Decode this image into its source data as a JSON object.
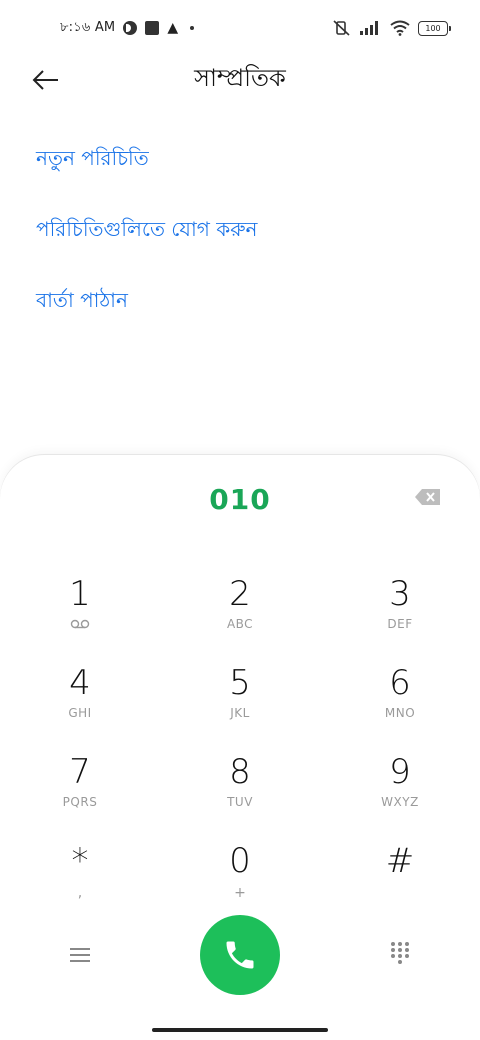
{
  "status_bar": {
    "time": "৮:১৬ AM",
    "battery": "100",
    "icons": [
      "circle-app-icon",
      "square-app-icon",
      "warning-icon",
      "dot-icon",
      "muted-vibrate-icon",
      "signal-icon",
      "wifi-icon",
      "battery-icon"
    ]
  },
  "header": {
    "title": "সাম্প্রতিক",
    "back_icon": "arrow-left-icon"
  },
  "actions": [
    {
      "label": "নতুন পরিচিতি"
    },
    {
      "label": "পরিচিতিগুলিতে যোগ করুন"
    },
    {
      "label": "বার্তা পাঠান"
    }
  ],
  "dialer": {
    "number": "010",
    "backspace_icon": "backspace-icon",
    "keys": [
      {
        "digit": "1",
        "letters": "",
        "icon": "voicemail-icon"
      },
      {
        "digit": "2",
        "letters": "ABC"
      },
      {
        "digit": "3",
        "letters": "DEF"
      },
      {
        "digit": "4",
        "letters": "GHI"
      },
      {
        "digit": "5",
        "letters": "JKL"
      },
      {
        "digit": "6",
        "letters": "MNO"
      },
      {
        "digit": "7",
        "letters": "PQRS"
      },
      {
        "digit": "8",
        "letters": "TUV"
      },
      {
        "digit": "9",
        "letters": "WXYZ"
      },
      {
        "digit": "*",
        "letters": ","
      },
      {
        "digit": "0",
        "letters": "+"
      },
      {
        "digit": "#",
        "letters": ""
      }
    ],
    "bottom": {
      "menu_icon": "menu-icon",
      "call_icon": "phone-icon",
      "keypad_icon": "dialpad-icon"
    },
    "colors": {
      "accent": "#1dbf5a",
      "number": "#1aa657",
      "link": "#1a73e8"
    }
  }
}
